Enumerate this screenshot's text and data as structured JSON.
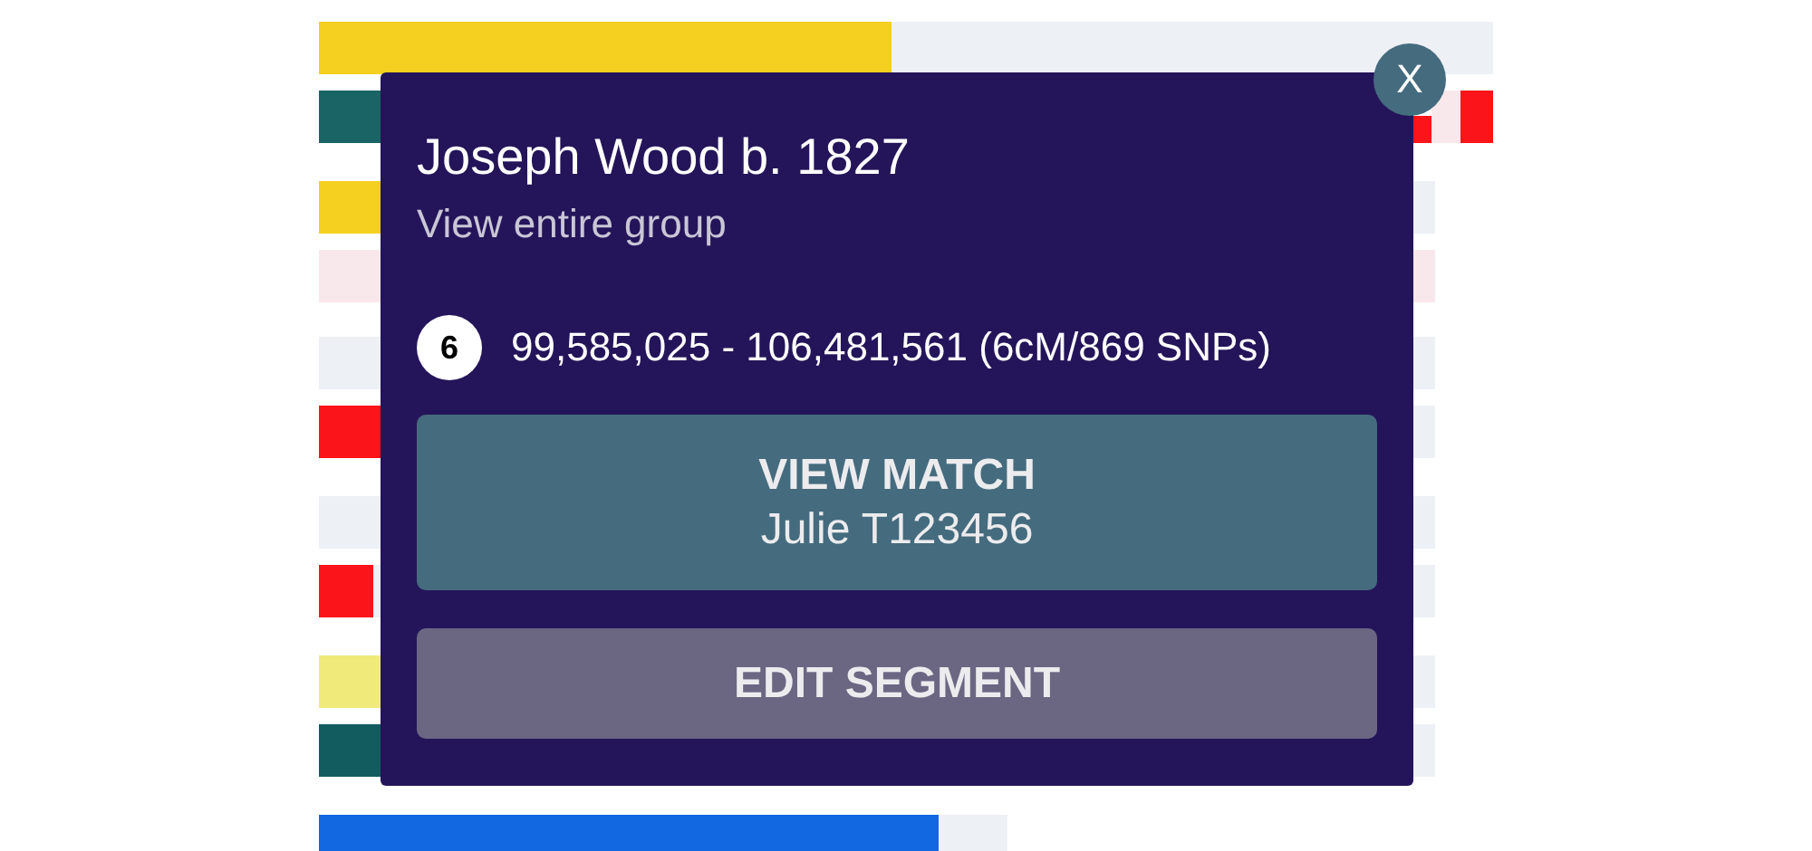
{
  "popup": {
    "title": "Joseph Wood b. 1827",
    "link": "View entire group",
    "chromosome": "6",
    "segment": "99,585,025 - 106,481,561 (6cM/869 SNPs)",
    "buttons": [
      {
        "kind": "primary",
        "label": "VIEW MATCH",
        "sublabel": "Julie T123456"
      },
      {
        "kind": "secondary",
        "label": "EDIT SEGMENT"
      }
    ],
    "close": "X"
  }
}
